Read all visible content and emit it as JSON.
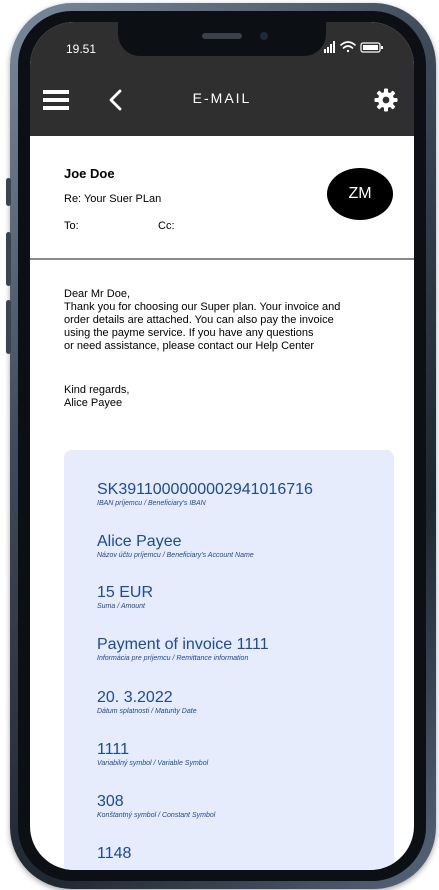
{
  "status_bar": {
    "time": "19.51",
    "icons": [
      "signal-icon",
      "wifi-icon",
      "battery-icon"
    ]
  },
  "header": {
    "title": "E-MAIL",
    "icons": [
      "menu-icon",
      "back-icon",
      "gear-icon"
    ]
  },
  "email": {
    "sender": "Joe Doe",
    "subject": "Re: Your  Suer PLan",
    "to_label": "To:",
    "cc_label": "Cc:",
    "avatar_initials": "ZM"
  },
  "body": {
    "greeting": "Dear Mr Doe,",
    "lines": [
      "Thank you for choosing our Super plan. Your invoice and",
      "order details are attached. You can also pay the invoice",
      "using the payme service. If you have any questions",
      "or need assistance, please contact our Help Center"
    ],
    "closing": "Kind regards,",
    "signature": "Alice Payee"
  },
  "payment": {
    "items": [
      {
        "value": "SK3911000000002941016716",
        "label": "IBAN príjemcu / Beneficiary's IBAN"
      },
      {
        "value": "Alice Payee",
        "label": "Názov účtu príjemcu / Beneficiary's Account Name"
      },
      {
        "value": "15 EUR",
        "label": "Suma / Amount"
      },
      {
        "value": "Payment of invoice 1111",
        "label": "Informácia pre príjemcu / Remittance information"
      },
      {
        "value": "20. 3.2022",
        "label": "Dátum splatnosti / Maturity Date"
      },
      {
        "value": "1111",
        "label": "Variabilný symbol / Variable Symbol"
      },
      {
        "value": "308",
        "label": "Konštantný symbol / Constant Symbol"
      },
      {
        "value": "1148",
        "label": ""
      }
    ]
  },
  "colors": {
    "header_bg": "#2f2f2f",
    "card_bg": "#e6ecfb",
    "accent_text": "#1a4aa3"
  }
}
